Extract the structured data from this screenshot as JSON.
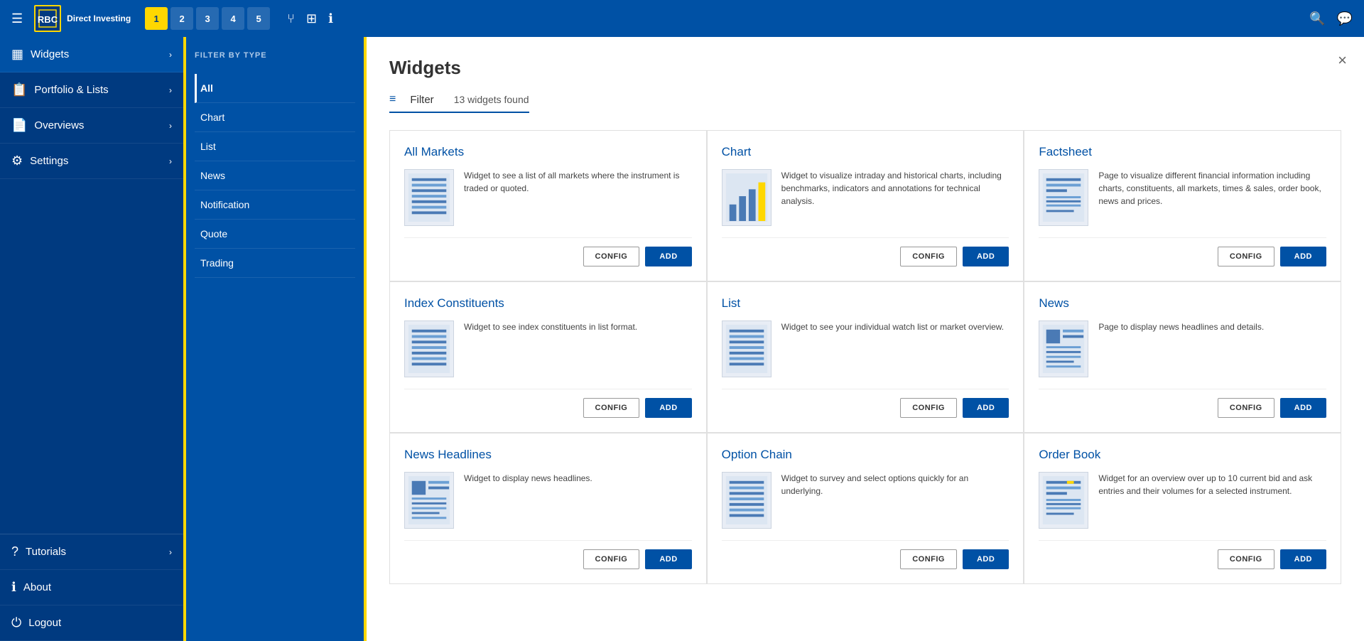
{
  "topnav": {
    "brand": "RBC",
    "appname": "Direct Investing",
    "tabs": [
      {
        "label": "1",
        "active": true
      },
      {
        "label": "2",
        "active": false
      },
      {
        "label": "3",
        "active": false
      },
      {
        "label": "4",
        "active": false
      },
      {
        "label": "5",
        "active": false
      }
    ],
    "icons": [
      "☰",
      "✦",
      "⊞",
      "ℹ"
    ],
    "right_icons": [
      "🔍",
      "💬"
    ]
  },
  "sidebar": {
    "items": [
      {
        "label": "Widgets",
        "icon": "▦",
        "active": true
      },
      {
        "label": "Portfolio & Lists",
        "icon": "📋",
        "active": false
      },
      {
        "label": "Overviews",
        "icon": "📄",
        "active": false
      },
      {
        "label": "Settings",
        "icon": "⚙",
        "active": false
      }
    ],
    "bottom_items": [
      {
        "label": "Tutorials",
        "icon": "?"
      },
      {
        "label": "About",
        "icon": "ℹ"
      },
      {
        "label": "Logout",
        "icon": "⏻"
      }
    ]
  },
  "filter": {
    "title": "FILTER BY TYPE",
    "items": [
      {
        "label": "All",
        "active": true
      },
      {
        "label": "Chart",
        "active": false
      },
      {
        "label": "List",
        "active": false
      },
      {
        "label": "News",
        "active": false
      },
      {
        "label": "Notification",
        "active": false
      },
      {
        "label": "Quote",
        "active": false
      },
      {
        "label": "Trading",
        "active": false
      }
    ]
  },
  "widgets": {
    "panel_title": "Widgets",
    "filter_label": "Filter",
    "count_text": "13 widgets found",
    "close_label": "×",
    "cards": [
      {
        "title": "All Markets",
        "description": "Widget to see a list of all markets where the instrument is traded or quoted.",
        "has_config": true,
        "has_add": true,
        "thumb_type": "grid"
      },
      {
        "title": "Chart",
        "description": "Widget to visualize intraday and historical charts, including benchmarks, indicators and annotations for technical analysis.",
        "has_config": true,
        "has_add": true,
        "thumb_type": "bar"
      },
      {
        "title": "Factsheet",
        "description": "Page to visualize different financial information including charts, constituents, all markets, times & sales, order book, news and prices.",
        "has_config": true,
        "has_add": true,
        "thumb_type": "doc"
      },
      {
        "title": "Index Constituents",
        "description": "Widget to see index constituents in list format.",
        "has_config": true,
        "has_add": true,
        "thumb_type": "grid"
      },
      {
        "title": "List",
        "description": "Widget to see your individual watch list or market overview.",
        "has_config": true,
        "has_add": true,
        "thumb_type": "grid"
      },
      {
        "title": "News",
        "description": "Page to display news headlines and details.",
        "has_config": true,
        "has_add": true,
        "thumb_type": "news"
      },
      {
        "title": "News Headlines",
        "description": "Widget to display news headlines.",
        "has_config": true,
        "has_add": true,
        "thumb_type": "news"
      },
      {
        "title": "Option Chain",
        "description": "Widget to survey and select options quickly for an underlying.",
        "has_config": true,
        "has_add": true,
        "thumb_type": "grid"
      },
      {
        "title": "Order Book",
        "description": "Widget for an overview over up to 10 current bid and ask entries and their volumes for a selected instrument.",
        "has_config": true,
        "has_add": true,
        "thumb_type": "doc"
      }
    ],
    "btn_config": "CONFIG",
    "btn_add": "ADD"
  }
}
